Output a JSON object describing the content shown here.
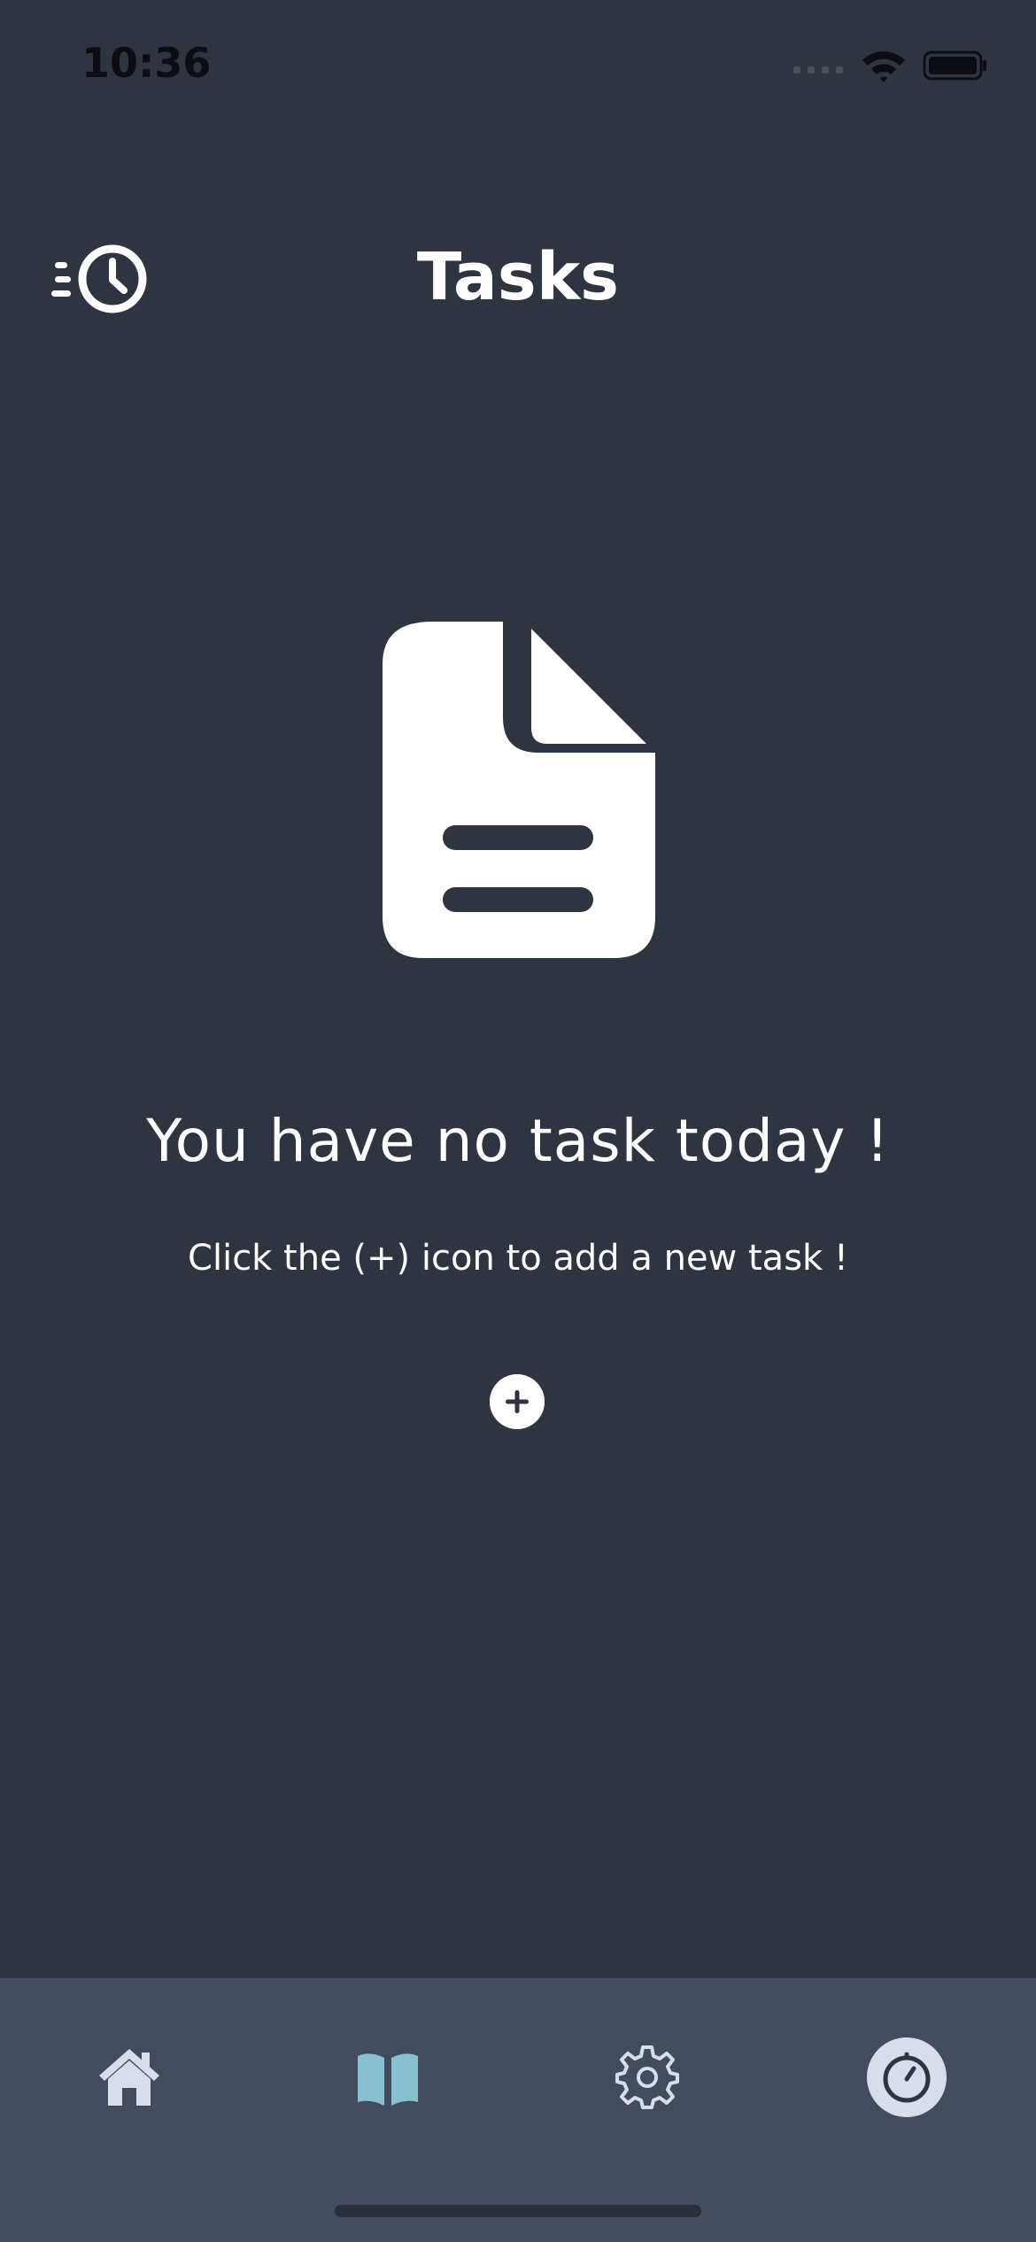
{
  "status_bar": {
    "time": "10:36"
  },
  "header": {
    "title": "Tasks",
    "history_icon": "history-clock-icon"
  },
  "empty_state": {
    "icon": "document-icon",
    "title": "You have no task today !",
    "subtitle": "Click the (+) icon to add a new task !",
    "add_icon": "plus-circle-icon"
  },
  "bottom_nav": {
    "items": [
      {
        "icon": "home-icon"
      },
      {
        "icon": "book-icon"
      },
      {
        "icon": "gear-icon"
      },
      {
        "icon": "timer-icon",
        "selected": true
      }
    ]
  },
  "colors": {
    "background": "#2e3440",
    "nav_background": "#434c5e",
    "text": "#ffffff",
    "nav_icon_inactive": "#d8dee9",
    "nav_icon_book": "#88c0d0",
    "nav_selected_bubble": "#d8dee9"
  }
}
